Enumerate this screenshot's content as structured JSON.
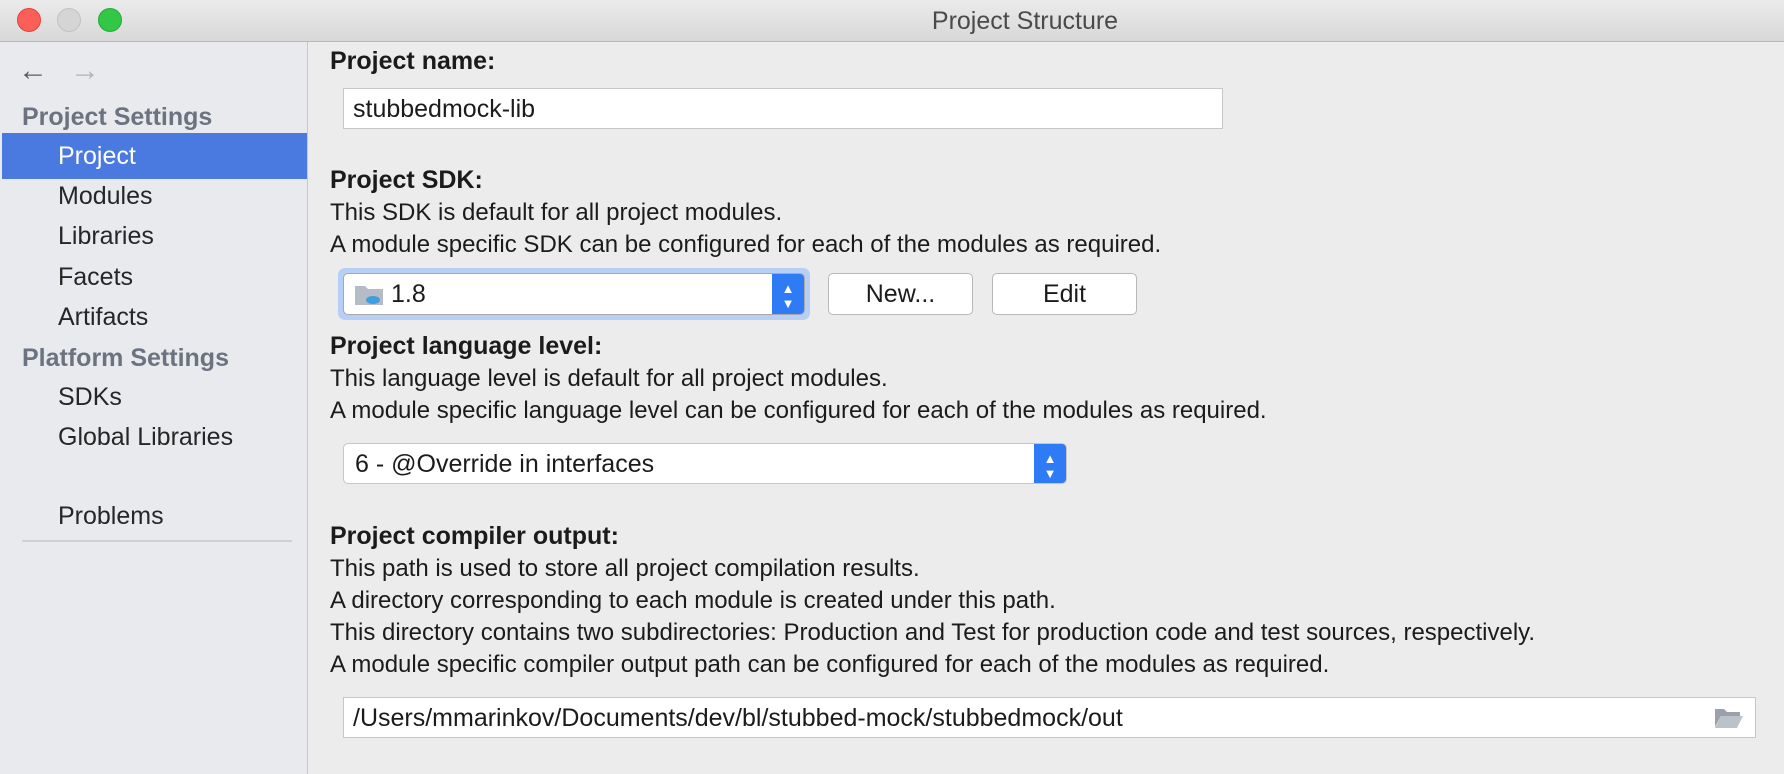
{
  "window": {
    "title": "Project Structure"
  },
  "sidebar": {
    "sections": [
      {
        "title": "Project Settings",
        "items": [
          "Project",
          "Modules",
          "Libraries",
          "Facets",
          "Artifacts"
        ]
      },
      {
        "title": "Platform Settings",
        "items": [
          "SDKs",
          "Global Libraries"
        ]
      }
    ],
    "problems_label": "Problems",
    "selected": "Project"
  },
  "project_name": {
    "label": "Project name:",
    "value": "stubbedmock-lib"
  },
  "sdk": {
    "label": "Project SDK:",
    "desc1": "This SDK is default for all project modules.",
    "desc2": "A module specific SDK can be configured for each of the modules as required.",
    "selected": "1.8",
    "new_button": "New...",
    "edit_button": "Edit"
  },
  "language_level": {
    "label": "Project language level:",
    "desc1": "This language level is default for all project modules.",
    "desc2": "A module specific language level can be configured for each of the modules as required.",
    "selected": "6 - @Override in interfaces"
  },
  "compiler_output": {
    "label": "Project compiler output:",
    "desc1": "This path is used to store all project compilation results.",
    "desc2": "A directory corresponding to each module is created under this path.",
    "desc3": "This directory contains two subdirectories: Production and Test for production code and test sources, respectively.",
    "desc4": "A module specific compiler output path can be configured for each of the modules as required.",
    "path": "/Users/mmarinkov/Documents/dev/bl/stubbed-mock/stubbedmock/out"
  },
  "icons": {
    "back": "arrow-left-icon",
    "forward": "arrow-right-icon",
    "sdk": "java-sdk-folder-icon",
    "browse": "folder-open-icon"
  },
  "colors": {
    "selection": "#4a79e0",
    "combo_arrow": "#2f7bf6",
    "close": "#fc5f57",
    "maximize": "#33c748"
  }
}
